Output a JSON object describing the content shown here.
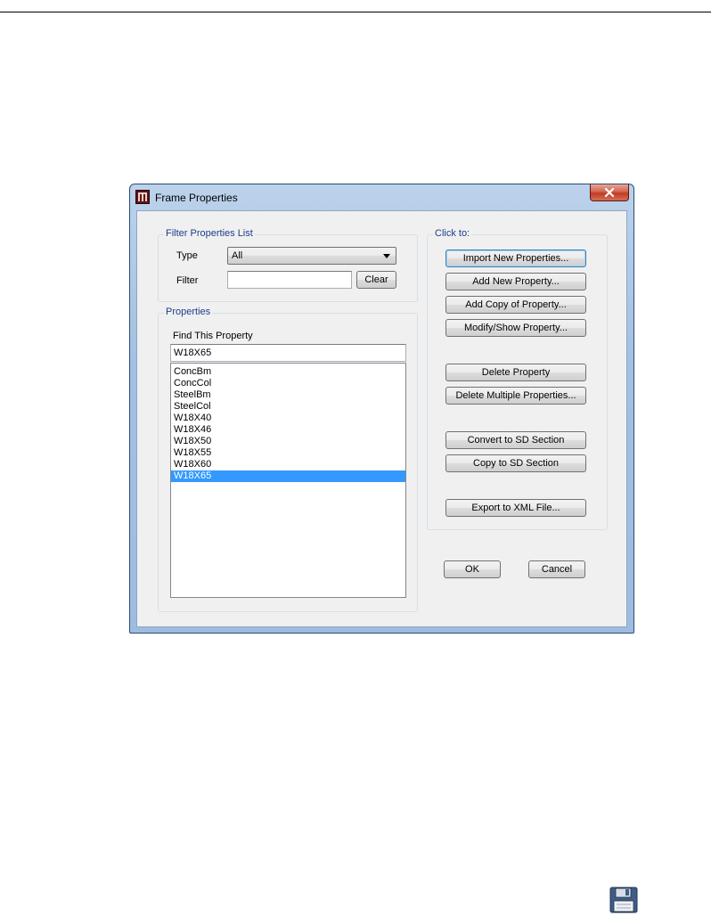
{
  "window": {
    "title": "Frame Properties"
  },
  "filter_group": {
    "legend": "Filter Properties List",
    "type_label": "Type",
    "type_value": "All",
    "filter_label": "Filter",
    "filter_value": "",
    "clear_label": "Clear"
  },
  "properties_group": {
    "legend": "Properties",
    "find_label": "Find This Property",
    "find_value": "W18X65",
    "items": [
      "ConcBm",
      "ConcCol",
      "SteelBm",
      "SteelCol",
      "W18X40",
      "W18X46",
      "W18X50",
      "W18X55",
      "W18X60",
      "W18X65"
    ],
    "selected": "W18X65"
  },
  "actions_group": {
    "legend": "Click to:",
    "import_new": "Import New Properties...",
    "add_new": "Add New Property...",
    "add_copy": "Add Copy of Property...",
    "modify_show": "Modify/Show Property...",
    "delete": "Delete Property",
    "delete_multiple": "Delete Multiple Properties...",
    "convert_sd": "Convert to SD Section",
    "copy_sd": "Copy to SD Section",
    "export_xml": "Export to XML File..."
  },
  "footer": {
    "ok": "OK",
    "cancel": "Cancel"
  },
  "icons": {
    "app": "frame-properties-app-icon",
    "close": "close-icon",
    "dropdown": "chevron-down-icon",
    "floppy": "floppy-disk-icon"
  },
  "colors": {
    "selection": "#3399ff",
    "legend_text": "#1c3c8c",
    "close_button": "#c23b22",
    "window_frame": "#a3c0e2"
  }
}
